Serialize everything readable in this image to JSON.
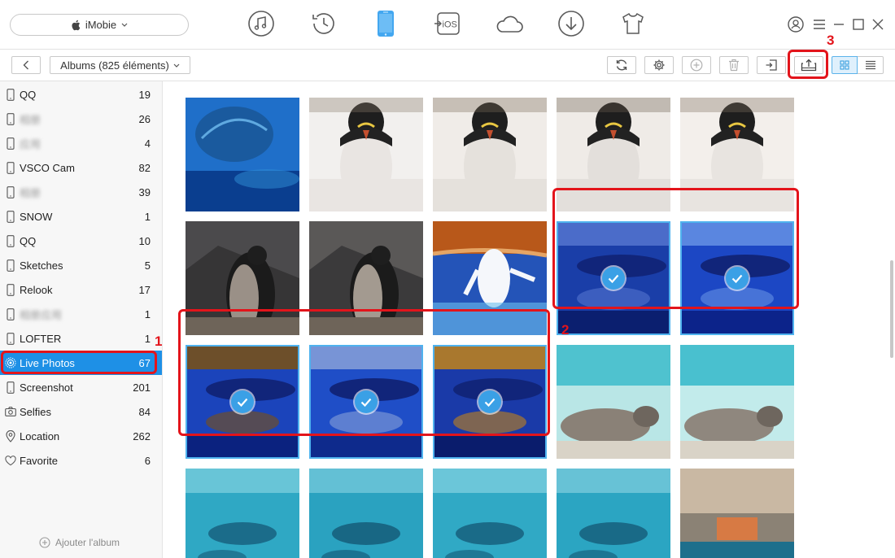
{
  "header": {
    "device_name": "iMobie",
    "nav_icons": [
      "music-icon",
      "history-icon",
      "phone-icon",
      "ios-icon",
      "cloud-icon",
      "download-icon",
      "tshirt-icon"
    ],
    "ios_label": "iOS"
  },
  "toolbar": {
    "album_label": "Albums (825 éléments)"
  },
  "sidebar": {
    "items": [
      {
        "name": "QQ",
        "count": "19",
        "icon": "phone-icon",
        "blur": false
      },
      {
        "name": "相册",
        "count": "26",
        "icon": "phone-icon",
        "blur": true
      },
      {
        "name": "应用",
        "count": "4",
        "icon": "phone-icon",
        "blur": true
      },
      {
        "name": "VSCO Cam",
        "count": "82",
        "icon": "phone-icon",
        "blur": false
      },
      {
        "name": "相册",
        "count": "39",
        "icon": "phone-icon",
        "blur": true
      },
      {
        "name": "SNOW",
        "count": "1",
        "icon": "phone-icon",
        "blur": false
      },
      {
        "name": "QQ",
        "count": "10",
        "icon": "phone-icon",
        "blur": false
      },
      {
        "name": "Sketches",
        "count": "5",
        "icon": "phone-icon",
        "blur": false
      },
      {
        "name": "Relook",
        "count": "17",
        "icon": "phone-icon",
        "blur": false
      },
      {
        "name": "相册应用",
        "count": "1",
        "icon": "phone-icon",
        "blur": true
      },
      {
        "name": "LOFTER",
        "count": "1",
        "icon": "phone-icon",
        "blur": false
      },
      {
        "name": "Live Photos",
        "count": "67",
        "icon": "live-photo-icon",
        "blur": false,
        "selected": true
      },
      {
        "name": "Screenshot",
        "count": "201",
        "icon": "phone-icon",
        "blur": false
      },
      {
        "name": "Selfies",
        "count": "84",
        "icon": "camera-icon",
        "blur": false
      },
      {
        "name": "Location",
        "count": "262",
        "icon": "location-pin-icon",
        "blur": false
      },
      {
        "name": "Favorite",
        "count": "6",
        "icon": "heart-icon",
        "blur": false
      }
    ],
    "add_album_label": "Ajouter l'album"
  },
  "photos": [
    {
      "subject": "turtle",
      "colors": [
        "#1f6fc9",
        "#0a3e8f",
        "#2f8fd8"
      ],
      "selected": false
    },
    {
      "subject": "penguin",
      "colors": [
        "#e9e5e2",
        "#8a7b6a",
        "#f2f0ee"
      ],
      "selected": false
    },
    {
      "subject": "penguin",
      "colors": [
        "#e5e1dc",
        "#7c6c5a",
        "#f0ece8"
      ],
      "selected": false
    },
    {
      "subject": "penguin",
      "colors": [
        "#e3dfdb",
        "#6d5e4f",
        "#efebe7"
      ],
      "selected": false
    },
    {
      "subject": "penguin",
      "colors": [
        "#e8e4e0",
        "#7f705f",
        "#f3efeb"
      ],
      "selected": false
    },
    {
      "subject": "penguin-back",
      "colors": [
        "#4b4a4c",
        "#9a9087",
        "#2d2c2e"
      ],
      "selected": false
    },
    {
      "subject": "penguin-back",
      "colors": [
        "#5a5857",
        "#a39a90",
        "#2e2d2f"
      ],
      "selected": false
    },
    {
      "subject": "penguin-swim",
      "colors": [
        "#2454b8",
        "#b8581a",
        "#6cc0ee"
      ],
      "selected": false
    },
    {
      "subject": "penguin-underwater",
      "colors": [
        "#1a3ea8",
        "#4b6cc9",
        "#0b1f6f"
      ],
      "selected": true
    },
    {
      "subject": "penguin-underwater",
      "colors": [
        "#1c47c4",
        "#5a86e0",
        "#0c238a"
      ],
      "selected": true
    },
    {
      "subject": "penguin-underwater",
      "colors": [
        "#1b44bb",
        "#6d4f2a",
        "#0b227f"
      ],
      "selected": true
    },
    {
      "subject": "penguin-underwater",
      "colors": [
        "#1f4ec7",
        "#7894d6",
        "#0e2a8c"
      ],
      "selected": true
    },
    {
      "subject": "penguin-underwater",
      "colors": [
        "#1a3aa8",
        "#a9782e",
        "#0a1c6c"
      ],
      "selected": true
    },
    {
      "subject": "seal",
      "colors": [
        "#4fc2cf",
        "#b9e6e6",
        "#8a8177"
      ],
      "selected": false
    },
    {
      "subject": "seal",
      "colors": [
        "#49c0cf",
        "#c2ebeb",
        "#8f877e"
      ],
      "selected": false
    },
    {
      "subject": "seal-pool",
      "colors": [
        "#2fa8c4",
        "#8fd8e4",
        "#1b6c8a"
      ],
      "selected": false
    },
    {
      "subject": "seal-pool",
      "colors": [
        "#2aa2c0",
        "#8ad4e2",
        "#186784"
      ],
      "selected": false
    },
    {
      "subject": "seal-pool",
      "colors": [
        "#30a9c5",
        "#92dae6",
        "#1a6b88"
      ],
      "selected": false
    },
    {
      "subject": "seal-pool",
      "colors": [
        "#2ba5c2",
        "#8fd6e3",
        "#196a87"
      ],
      "selected": false
    },
    {
      "subject": "aquarium-show",
      "colors": [
        "#c9b8a3",
        "#d77a44",
        "#1e6f8c"
      ],
      "selected": false
    }
  ],
  "annotations": {
    "num1": "1",
    "num2": "2",
    "num3": "3"
  }
}
